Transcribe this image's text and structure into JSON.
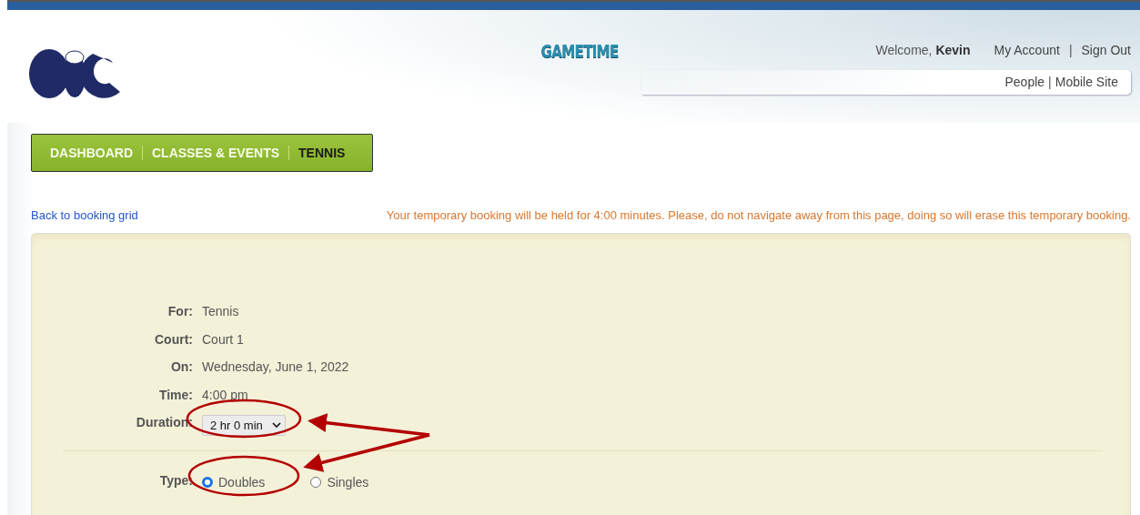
{
  "header": {
    "brand": "GAMETIME",
    "welcome": "Welcome,",
    "user": "Kevin",
    "separator": "|",
    "top_links": [
      "My Account",
      "Sign Out"
    ],
    "sub_links": [
      "People",
      "Mobile Site"
    ]
  },
  "nav": [
    {
      "label": "DASHBOARD",
      "selected": false
    },
    {
      "label": "CLASSES & EVENTS",
      "selected": false
    },
    {
      "label": "TENNIS",
      "selected": true
    }
  ],
  "back_link": "Back to booking grid",
  "notice": "Your temporary booking will be held for 4:00 minutes. Please, do not navigate away from this page, doing so will erase this temporary booking.",
  "details": [
    {
      "label": "For:",
      "value": "Tennis"
    },
    {
      "label": "Court:",
      "value": "Court 1"
    },
    {
      "label": "On:",
      "value": "Wednesday, June 1, 2022"
    },
    {
      "label": "Time:",
      "value": "4:00 pm"
    }
  ],
  "duration": {
    "label": "Duration:",
    "value": "2 hr 0 min"
  },
  "type": {
    "label": "Type:",
    "options": [
      {
        "label": "Doubles",
        "selected": true
      },
      {
        "label": "Singles",
        "selected": false
      }
    ]
  }
}
